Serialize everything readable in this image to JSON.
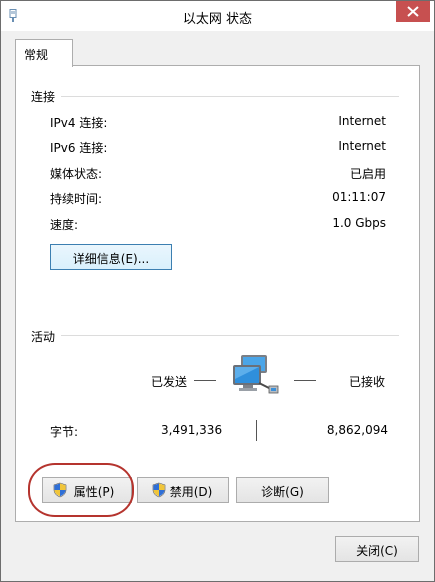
{
  "window": {
    "title": "以太网 状态"
  },
  "tabs": [
    {
      "label": "常规"
    }
  ],
  "connection": {
    "heading": "连接",
    "rows": [
      {
        "label": "IPv4 连接:",
        "value": "Internet"
      },
      {
        "label": "IPv6 连接:",
        "value": "Internet"
      },
      {
        "label": "媒体状态:",
        "value": "已启用"
      },
      {
        "label": "持续时间:",
        "value": "01:11:07"
      },
      {
        "label": "速度:",
        "value": "1.0 Gbps"
      }
    ],
    "details_button": "详细信息(E)..."
  },
  "activity": {
    "heading": "活动",
    "sent_label": "已发送",
    "received_label": "已接收",
    "bytes_label": "字节:",
    "bytes_sent": "3,491,336",
    "bytes_received": "8,862,094"
  },
  "buttons": {
    "properties": "属性(P)",
    "disable": "禁用(D)",
    "diagnose": "诊断(G)",
    "close": "关闭(C)"
  },
  "icons": {
    "app": "network-adapter-icon",
    "network": "network-computer-icon",
    "shield": "uac-shield-icon",
    "close": "close-icon"
  },
  "colors": {
    "close_button": "#c75050",
    "highlight_circle": "#b5342e",
    "focus_border": "#3c7fb1"
  }
}
